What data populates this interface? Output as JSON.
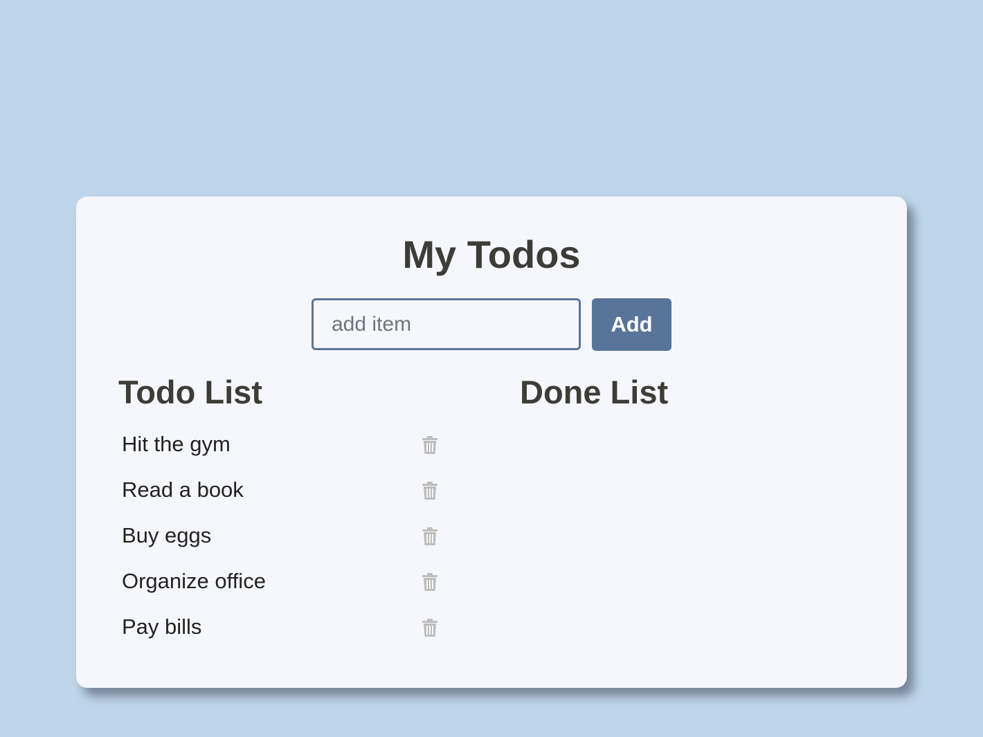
{
  "app": {
    "title": "My Todos"
  },
  "form": {
    "input_value": "",
    "input_placeholder": "add item",
    "add_label": "Add"
  },
  "todo": {
    "heading": "Todo List",
    "items": [
      {
        "label": "Hit the gym",
        "icon": "trash-icon"
      },
      {
        "label": "Read a book",
        "icon": "trash-icon"
      },
      {
        "label": "Buy eggs",
        "icon": "trash-icon"
      },
      {
        "label": "Organize office",
        "icon": "trash-icon"
      },
      {
        "label": "Pay bills",
        "icon": "trash-icon"
      }
    ]
  },
  "done": {
    "heading": "Done List",
    "items": []
  },
  "colors": {
    "background": "#bfd5e9",
    "card": "#f6f7fc",
    "accent": "#587599",
    "text": "#3d3d38",
    "icon": "#bdbdbd"
  }
}
